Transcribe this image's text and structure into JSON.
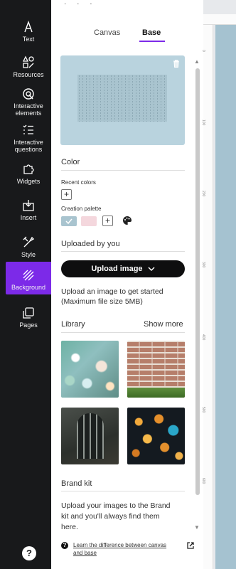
{
  "rail": {
    "items": [
      {
        "label": "Text",
        "icon": "text-icon"
      },
      {
        "label": "Resources",
        "icon": "shapes-icon"
      },
      {
        "label": "Interactive elements",
        "icon": "interactive-icon"
      },
      {
        "label": "Interactive questions",
        "icon": "questions-icon"
      },
      {
        "label": "Widgets",
        "icon": "puzzle-icon"
      },
      {
        "label": "Insert",
        "icon": "insert-icon"
      },
      {
        "label": "Style",
        "icon": "style-icon"
      },
      {
        "label": "Background",
        "icon": "background-icon"
      },
      {
        "label": "Pages",
        "icon": "pages-icon"
      }
    ],
    "active": "Background",
    "help_label": "?"
  },
  "panel": {
    "tabs": {
      "canvas": "Canvas",
      "base": "Base",
      "active": "Base"
    },
    "color": {
      "title": "Color",
      "recent_label": "Recent colors",
      "palette_label": "Creation palette",
      "add": "+",
      "swatches": [
        "#a9c4cf",
        "#f4d7dd"
      ]
    },
    "uploaded": {
      "title": "Uploaded by you",
      "button": "Upload image",
      "hint_line1": "Upload an image to get started",
      "hint_line2": "(Maximum file size 5MB)"
    },
    "library": {
      "title": "Library",
      "show_more": "Show more"
    },
    "brand": {
      "title": "Brand kit",
      "line1": "Upload your images to the Brand",
      "line2": "kit and you'll always find them",
      "line3": "here."
    },
    "footer": {
      "info": "?",
      "link_line1": "Learn the difference between canvas",
      "link_line2": "and base"
    }
  },
  "ruler": {
    "ticks": [
      "0",
      "100",
      "200",
      "300",
      "400",
      "500",
      "600"
    ]
  },
  "colors": {
    "accent": "#7c2ae8",
    "rail": "#18191b",
    "canvas": "#a5c2d0"
  }
}
